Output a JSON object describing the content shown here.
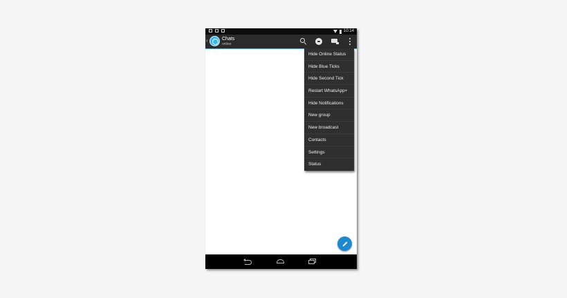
{
  "status_bar": {
    "time": "10:14",
    "icons": [
      "notification-icon",
      "camera-icon",
      "image-icon",
      "wifi-icon",
      "battery-icon"
    ]
  },
  "action_bar": {
    "title": "Chats",
    "subtitle": "online",
    "accent_color": "#33b5e5",
    "icons": [
      "search-icon",
      "new-chat-icon",
      "contacts-icon",
      "overflow-menu-icon"
    ]
  },
  "menu": {
    "items": [
      {
        "label": "Hide Online Status"
      },
      {
        "label": "Hide Blue Ticks"
      },
      {
        "label": "Hide Second Tick"
      },
      {
        "label": "Restart WhatsApp+"
      },
      {
        "label": "Hide Notifications"
      },
      {
        "label": "New group"
      },
      {
        "label": "New broadcast"
      },
      {
        "label": "Contacts"
      },
      {
        "label": "Settings"
      },
      {
        "label": "Status"
      }
    ]
  },
  "fab": {
    "icon": "pencil-icon",
    "color": "#1e88d0"
  },
  "nav_bar": {
    "icons": [
      "back-icon",
      "home-icon",
      "recents-icon"
    ]
  }
}
